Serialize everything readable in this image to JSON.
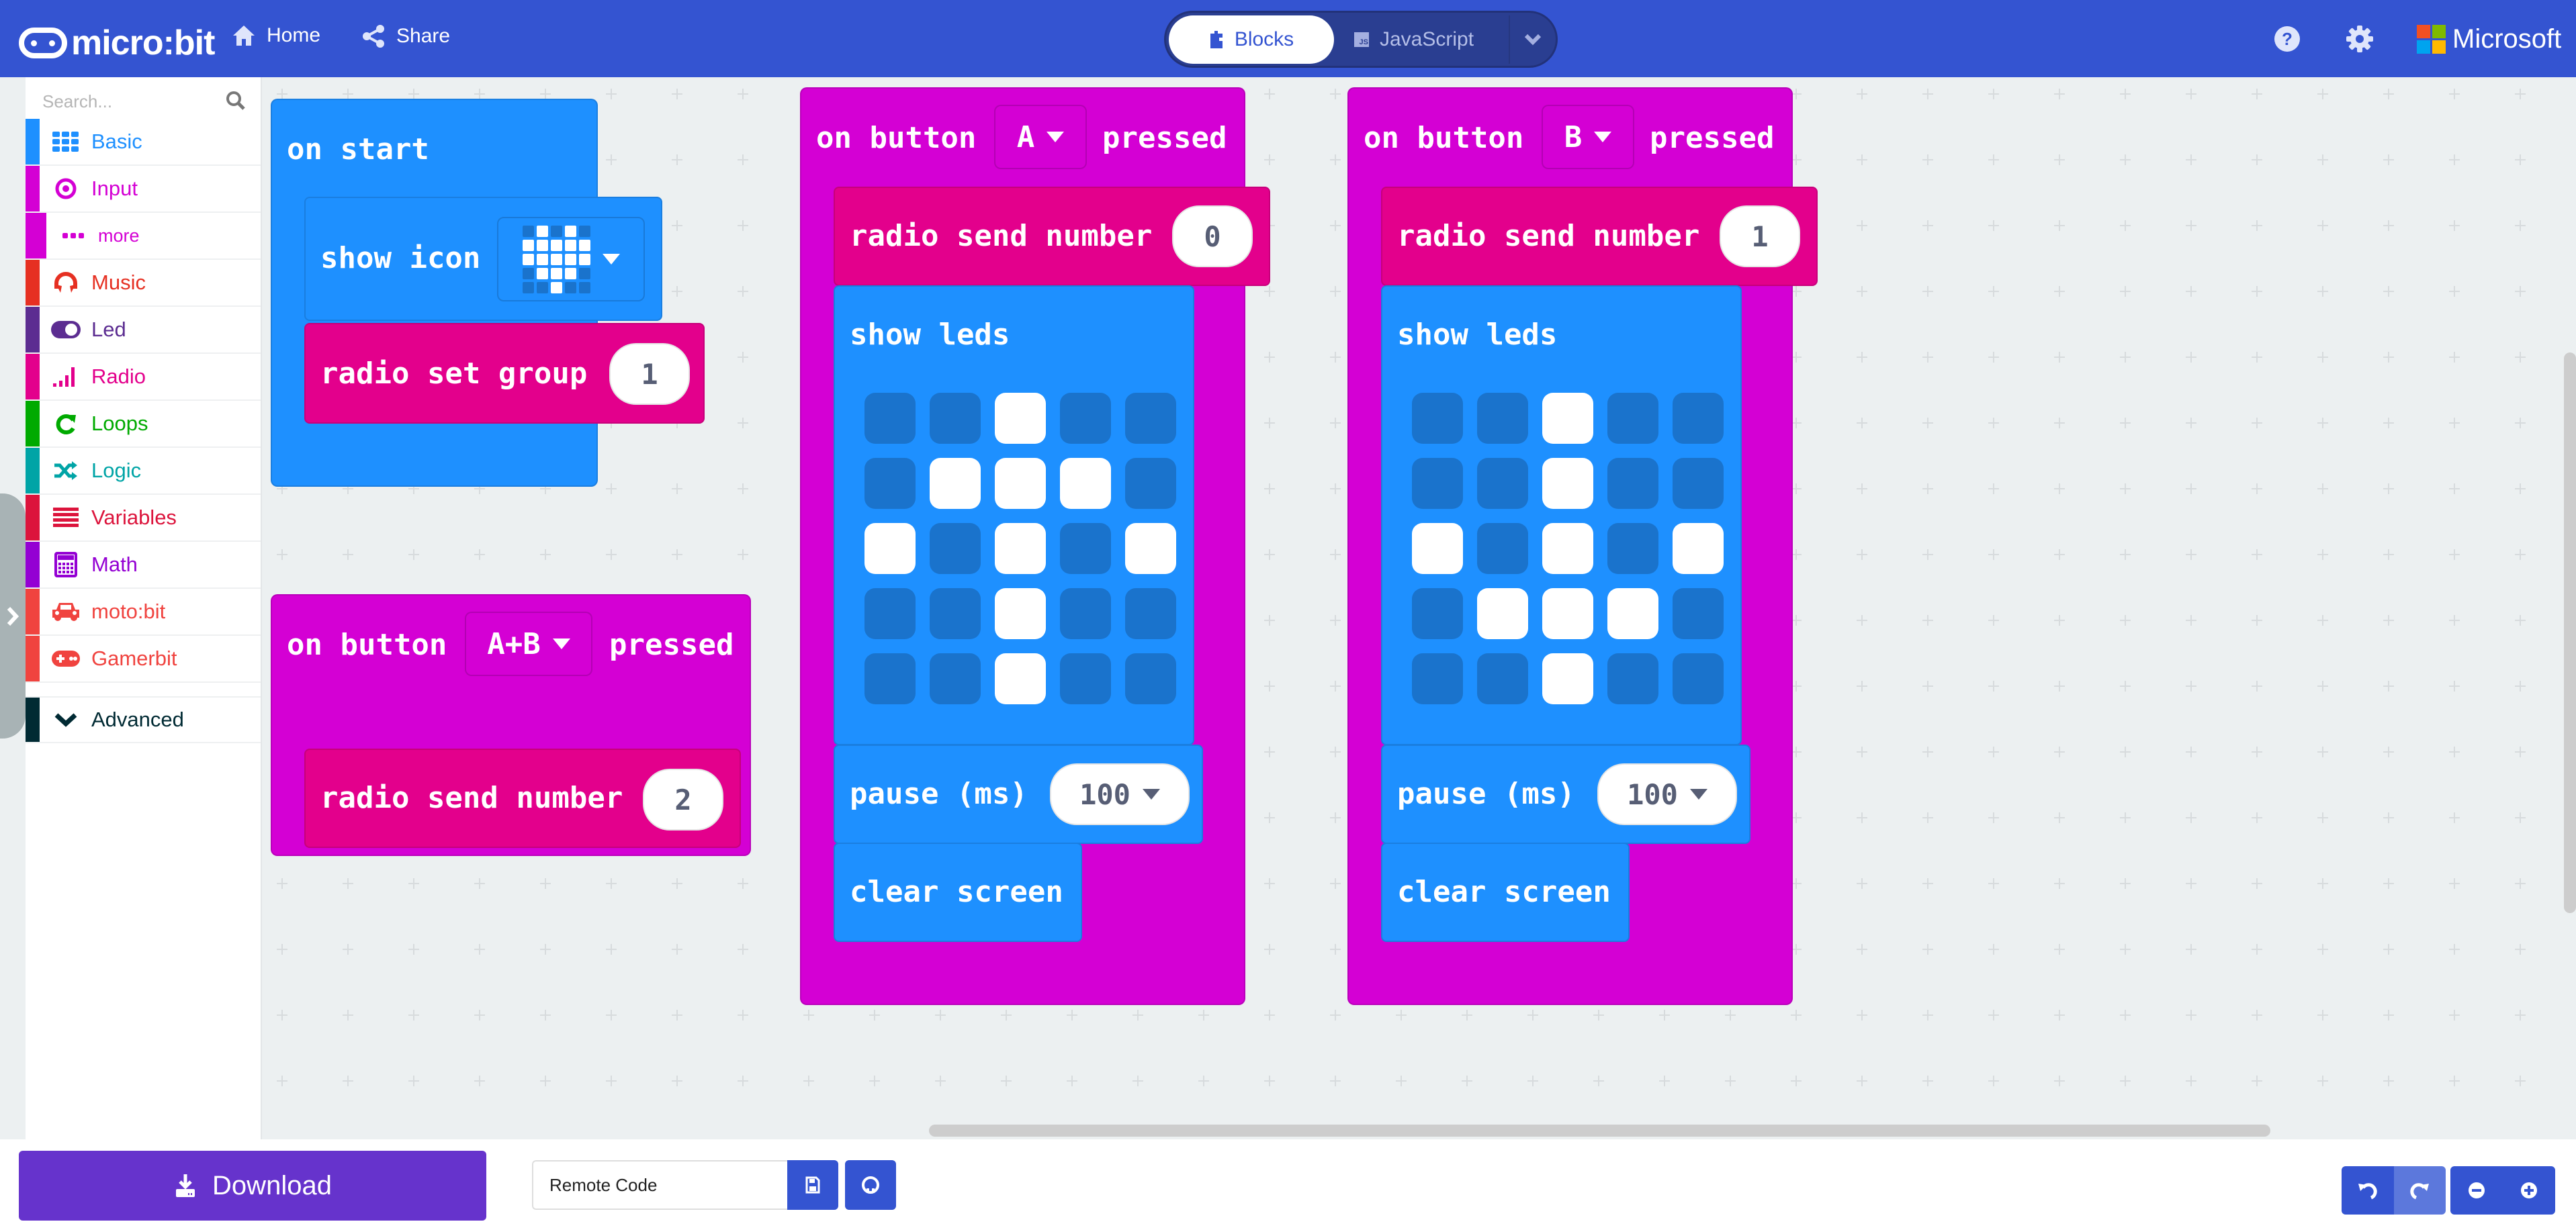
{
  "header": {
    "logo_text": "micro:bit",
    "home_label": "Home",
    "share_label": "Share",
    "tabs": [
      {
        "label": "Blocks",
        "active": true
      },
      {
        "label": "JavaScript",
        "active": false
      }
    ],
    "js_badge": "JS",
    "brand": "Microsoft",
    "icons": [
      "help-icon",
      "settings-gear-icon"
    ],
    "color": "#3454d1"
  },
  "toolbox": {
    "search_placeholder": "Search...",
    "categories": [
      {
        "label": "Basic",
        "color": "#1e90ff",
        "icon": "grid-icon"
      },
      {
        "label": "Input",
        "color": "#d400d4",
        "icon": "target-icon"
      },
      {
        "label": "more",
        "color": "#d400d4",
        "icon": "ellipsis-icon",
        "sub": true
      },
      {
        "label": "Music",
        "color": "#e63022",
        "icon": "headphones-icon"
      },
      {
        "label": "Led",
        "color": "#5c2d91",
        "icon": "toggle-icon"
      },
      {
        "label": "Radio",
        "color": "#e3008c",
        "icon": "signal-bars-icon"
      },
      {
        "label": "Loops",
        "color": "#00aa00",
        "icon": "refresh-icon"
      },
      {
        "label": "Logic",
        "color": "#00a4a6",
        "icon": "shuffle-icon"
      },
      {
        "label": "Variables",
        "color": "#dc143c",
        "icon": "list-lines-icon"
      },
      {
        "label": "Math",
        "color": "#9400d3",
        "icon": "calculator-icon"
      },
      {
        "label": "moto:bit",
        "color": "#f0433f",
        "icon": "car-icon"
      },
      {
        "label": "Gamerbit",
        "color": "#f0433f",
        "icon": "gamepad-icon"
      },
      {
        "label": "Advanced",
        "color": "#002a33",
        "icon": "chevron-down-icon"
      }
    ]
  },
  "workspace": {
    "on_start": {
      "title": "on start",
      "show_icon_label": "show icon",
      "icon_pattern": [
        [
          0,
          1,
          0,
          1,
          0
        ],
        [
          1,
          1,
          1,
          1,
          1
        ],
        [
          1,
          1,
          1,
          1,
          1
        ],
        [
          0,
          1,
          1,
          1,
          0
        ],
        [
          0,
          0,
          1,
          0,
          0
        ]
      ],
      "radio_set_group_label": "radio set group",
      "group_value": "1"
    },
    "on_button_ab": {
      "prefix": "on button",
      "button": "A+B",
      "suffix": "pressed",
      "send_label": "radio send number",
      "send_value": "2"
    },
    "on_button_a": {
      "prefix": "on button",
      "button": "A",
      "suffix": "pressed",
      "send_label": "radio send number",
      "send_value": "0",
      "show_leds_label": "show leds",
      "leds": [
        [
          0,
          0,
          1,
          0,
          0
        ],
        [
          0,
          1,
          1,
          1,
          0
        ],
        [
          1,
          0,
          1,
          0,
          1
        ],
        [
          0,
          0,
          1,
          0,
          0
        ],
        [
          0,
          0,
          1,
          0,
          0
        ]
      ],
      "pause_label": "pause (ms)",
      "pause_value": "100",
      "clear_label": "clear screen"
    },
    "on_button_b": {
      "prefix": "on button",
      "button": "B",
      "suffix": "pressed",
      "send_label": "radio send number",
      "send_value": "1",
      "show_leds_label": "show leds",
      "leds": [
        [
          0,
          0,
          1,
          0,
          0
        ],
        [
          0,
          0,
          1,
          0,
          0
        ],
        [
          1,
          0,
          1,
          0,
          1
        ],
        [
          0,
          1,
          1,
          1,
          0
        ],
        [
          0,
          0,
          1,
          0,
          0
        ]
      ],
      "pause_label": "pause (ms)",
      "pause_value": "100",
      "clear_label": "clear screen"
    },
    "colors": {
      "basic": "#1e90ff",
      "input": "#d400d4",
      "radio": "#e3008c"
    }
  },
  "footer": {
    "download_label": "Download",
    "project_name": "Remote Code",
    "download_color": "#6633cc"
  }
}
